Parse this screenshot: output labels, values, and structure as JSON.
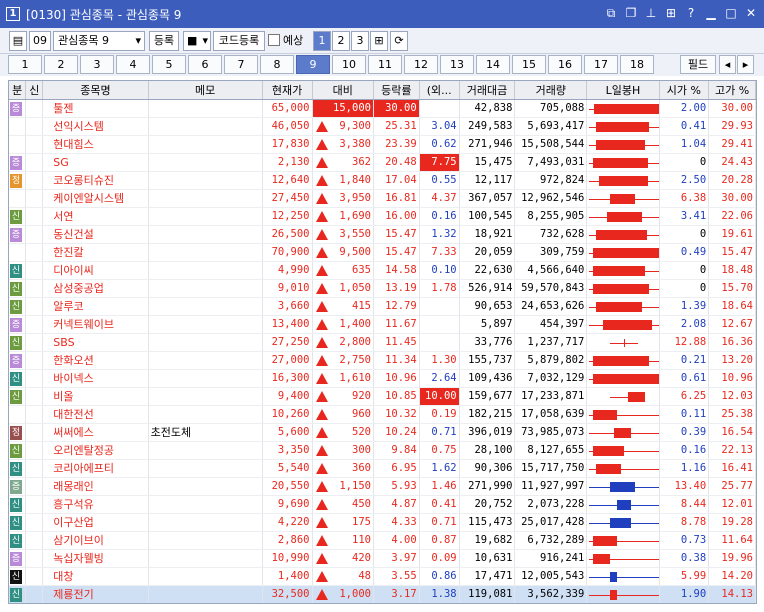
{
  "window": {
    "app_icon": "1",
    "title": "[0130] 관심종목 - 관심종목 9",
    "icons": [
      "restore-down-icon",
      "cascade-icon",
      "pin-icon",
      "grid-icon",
      "help-icon",
      "minimize-icon",
      "maximize-icon",
      "close-icon"
    ]
  },
  "toolbar": {
    "group_number": "09",
    "group_select": "관심종목 9",
    "register_label": "등록",
    "code_register_label": "코드등록",
    "forecast_label": "예상",
    "page_buttons": [
      "1",
      "2",
      "3"
    ]
  },
  "tabs": [
    "1",
    "2",
    "3",
    "4",
    "5",
    "6",
    "7",
    "8",
    "9",
    "10",
    "11",
    "12",
    "13",
    "14",
    "15",
    "16",
    "17",
    "18"
  ],
  "active_tab": "9",
  "field_label": "필드",
  "columns": [
    "분",
    "신",
    "종목명",
    "메모",
    "현재가",
    "대비",
    "등락률",
    "(외...",
    "거래대금",
    "거래량",
    "L일봉H",
    "시가 %",
    "고가 %"
  ],
  "rows": [
    {
      "b": "증",
      "bt": "jeung",
      "s": "",
      "name": "툴젠",
      "memo": "",
      "price": "65,000",
      "arrow": "up-arrow",
      "diff": "15,000",
      "rate": "30.00",
      "foreign": "",
      "fcolor": "",
      "amount": "42,838",
      "volume": "705,088",
      "open": "2.00",
      "high": "30.00",
      "candle": {
        "low": 0.0,
        "high": 1.0,
        "open": 0.07,
        "close": 1.0
      },
      "pricehl": false,
      "diffhl": true,
      "ratehl": true
    },
    {
      "b": "",
      "bt": "",
      "s": "",
      "name": "선익시스템",
      "memo": "",
      "price": "46,050",
      "arrow": "tri",
      "diff": "9,300",
      "rate": "25.31",
      "foreign": "3.04",
      "fcolor": "blue",
      "amount": "249,583",
      "volume": "5,693,417",
      "open": "0.41",
      "high": "29.93",
      "candle": {
        "low": 0.0,
        "high": 1.0,
        "open": 0.1,
        "close": 0.85
      }
    },
    {
      "b": "",
      "bt": "",
      "s": "",
      "name": "현대힘스",
      "memo": "",
      "price": "17,830",
      "arrow": "tri",
      "diff": "3,380",
      "rate": "23.39",
      "foreign": "0.62",
      "fcolor": "blue",
      "amount": "271,946",
      "volume": "15,508,544",
      "open": "1.04",
      "high": "29.41",
      "candle": {
        "low": 0.0,
        "high": 1.0,
        "open": 0.1,
        "close": 0.8
      }
    },
    {
      "b": "증",
      "bt": "jeung",
      "s": "",
      "name": "SG",
      "memo": "",
      "price": "2,130",
      "arrow": "tri",
      "diff": "362",
      "rate": "20.48",
      "foreign": "7.75",
      "fcolor": "hl",
      "amount": "15,475",
      "volume": "7,493,031",
      "open": "0",
      "high": "24.43",
      "candle": {
        "low": 0.0,
        "high": 1.0,
        "open": 0.05,
        "close": 0.84
      }
    },
    {
      "b": "정",
      "bt": "jeong",
      "s": "",
      "name": "코오롱티슈진",
      "memo": "",
      "price": "12,640",
      "arrow": "tri",
      "diff": "1,840",
      "rate": "17.04",
      "foreign": "0.55",
      "fcolor": "blue",
      "amount": "12,117",
      "volume": "972,824",
      "open": "2.50",
      "high": "20.28",
      "candle": {
        "low": 0.0,
        "high": 1.0,
        "open": 0.14,
        "close": 0.84
      }
    },
    {
      "b": "",
      "bt": "",
      "s": "",
      "name": "케이엔알시스템",
      "memo": "",
      "price": "27,450",
      "arrow": "tri",
      "diff": "3,950",
      "rate": "16.81",
      "foreign": "4.37",
      "fcolor": "red",
      "amount": "367,057",
      "volume": "12,962,546",
      "open": "6.38",
      "high": "30.00",
      "candle": {
        "low": 0.0,
        "high": 1.0,
        "open": 0.3,
        "close": 0.65
      }
    },
    {
      "b": "신",
      "bt": "sin",
      "s": "",
      "name": "서연",
      "memo": "",
      "price": "12,250",
      "arrow": "tri",
      "diff": "1,690",
      "rate": "16.00",
      "foreign": "0.16",
      "fcolor": "blue",
      "amount": "100,545",
      "volume": "8,255,905",
      "open": "3.41",
      "high": "22.06",
      "candle": {
        "low": 0.0,
        "high": 1.0,
        "open": 0.25,
        "close": 0.75
      }
    },
    {
      "b": "증",
      "bt": "jeung",
      "s": "",
      "name": "동신건설",
      "memo": "",
      "price": "26,500",
      "arrow": "tri",
      "diff": "3,550",
      "rate": "15.47",
      "foreign": "1.32",
      "fcolor": "blue",
      "amount": "18,921",
      "volume": "732,628",
      "open": "0",
      "high": "19.61",
      "candle": {
        "low": 0.0,
        "high": 1.0,
        "open": 0.1,
        "close": 0.82
      }
    },
    {
      "b": "",
      "bt": "",
      "s": "",
      "name": "한진칼",
      "memo": "",
      "price": "70,900",
      "arrow": "tri",
      "diff": "9,500",
      "rate": "15.47",
      "foreign": "7.33",
      "fcolor": "red",
      "amount": "20,059",
      "volume": "309,759",
      "open": "0.49",
      "high": "15.47",
      "candle": {
        "low": 0.0,
        "high": 1.0,
        "open": 0.05,
        "close": 1.0
      }
    },
    {
      "b": "신",
      "bt": "sin2",
      "s": "",
      "name": "디아이씨",
      "memo": "",
      "price": "4,990",
      "arrow": "tri",
      "diff": "635",
      "rate": "14.58",
      "foreign": "0.10",
      "fcolor": "blue",
      "amount": "22,630",
      "volume": "4,566,640",
      "open": "0",
      "high": "18.48",
      "candle": {
        "low": 0.0,
        "high": 1.0,
        "open": 0.05,
        "close": 0.8
      }
    },
    {
      "b": "신",
      "bt": "sin",
      "s": "",
      "name": "삼성중공업",
      "memo": "",
      "price": "9,010",
      "arrow": "tri",
      "diff": "1,050",
      "rate": "13.19",
      "foreign": "1.78",
      "fcolor": "red",
      "amount": "526,914",
      "volume": "59,570,843",
      "open": "0",
      "high": "15.70",
      "candle": {
        "low": 0.0,
        "high": 1.0,
        "open": 0.05,
        "close": 0.85
      }
    },
    {
      "b": "신",
      "bt": "sin",
      "s": "",
      "name": "알루코",
      "memo": "",
      "price": "3,660",
      "arrow": "tri",
      "diff": "415",
      "rate": "12.79",
      "foreign": "",
      "fcolor": "",
      "amount": "90,653",
      "volume": "24,653,626",
      "open": "1.39",
      "high": "18.64",
      "candle": {
        "low": 0.0,
        "high": 1.0,
        "open": 0.1,
        "close": 0.75
      }
    },
    {
      "b": "증",
      "bt": "jeung",
      "s": "",
      "name": "커넥트웨이브",
      "memo": "",
      "price": "13,400",
      "arrow": "tri",
      "diff": "1,400",
      "rate": "11.67",
      "foreign": "",
      "fcolor": "",
      "amount": "5,897",
      "volume": "454,397",
      "open": "2.08",
      "high": "12.67",
      "candle": {
        "low": 0.0,
        "high": 1.0,
        "open": 0.2,
        "close": 0.9
      }
    },
    {
      "b": "신",
      "bt": "sin",
      "s": "",
      "name": "SBS",
      "memo": "",
      "price": "27,250",
      "arrow": "tri",
      "diff": "2,800",
      "rate": "11.45",
      "foreign": "",
      "fcolor": "",
      "amount": "33,776",
      "volume": "1,237,717",
      "open": "12.88",
      "high": "16.36",
      "candle": {
        "low": 0.3,
        "high": 0.7,
        "open": 0.48,
        "close": 0.52,
        "flat": true
      }
    },
    {
      "b": "증",
      "bt": "jeung",
      "s": "",
      "name": "한화오션",
      "memo": "",
      "price": "27,000",
      "arrow": "tri",
      "diff": "2,750",
      "rate": "11.34",
      "foreign": "1.30",
      "fcolor": "red",
      "amount": "155,737",
      "volume": "5,879,802",
      "open": "0.21",
      "high": "13.20",
      "candle": {
        "low": 0.0,
        "high": 1.0,
        "open": 0.05,
        "close": 0.85
      }
    },
    {
      "b": "신",
      "bt": "sin2",
      "s": "",
      "name": "바이넥스",
      "memo": "",
      "price": "16,300",
      "arrow": "tri",
      "diff": "1,610",
      "rate": "10.96",
      "foreign": "2.64",
      "fcolor": "blue",
      "amount": "109,436",
      "volume": "7,032,129",
      "open": "0.61",
      "high": "10.96",
      "candle": {
        "low": 0.0,
        "high": 1.0,
        "open": 0.05,
        "close": 1.0
      }
    },
    {
      "b": "신",
      "bt": "sin",
      "s": "",
      "name": "비올",
      "memo": "",
      "price": "9,400",
      "arrow": "tri",
      "diff": "920",
      "rate": "10.85",
      "foreign": "10.00",
      "fcolor": "hl",
      "amount": "159,677",
      "volume": "17,233,871",
      "open": "6.25",
      "high": "12.03",
      "candle": {
        "low": 0.3,
        "high": 0.8,
        "open": 0.55,
        "close": 0.8
      }
    },
    {
      "b": "",
      "bt": "",
      "s": "",
      "name": "대한전선",
      "memo": "",
      "price": "10,260",
      "arrow": "tri",
      "diff": "960",
      "rate": "10.32",
      "foreign": "0.19",
      "fcolor": "red",
      "amount": "182,215",
      "volume": "17,058,639",
      "open": "0.11",
      "high": "25.38",
      "candle": {
        "low": 0.0,
        "high": 1.0,
        "open": 0.05,
        "close": 0.4
      }
    },
    {
      "b": "정",
      "bt": "jeong2",
      "s": "",
      "name": "써써에스",
      "memo": "초전도체",
      "price": "5,600",
      "arrow": "tri",
      "diff": "520",
      "rate": "10.24",
      "foreign": "0.71",
      "fcolor": "blue",
      "amount": "396,019",
      "volume": "73,985,073",
      "open": "0.39",
      "high": "16.54",
      "candle": {
        "low": 0.0,
        "high": 1.0,
        "open": 0.35,
        "close": 0.6
      }
    },
    {
      "b": "신",
      "bt": "sin",
      "s": "",
      "name": "오리엔탈정공",
      "memo": "",
      "price": "3,350",
      "arrow": "tri",
      "diff": "300",
      "rate": "9.84",
      "foreign": "0.75",
      "fcolor": "red",
      "amount": "28,100",
      "volume": "8,127,655",
      "open": "0.16",
      "high": "22.13",
      "candle": {
        "low": 0.0,
        "high": 1.0,
        "open": 0.05,
        "close": 0.5
      }
    },
    {
      "b": "신",
      "bt": "sin2",
      "s": "",
      "name": "코리아에프티",
      "memo": "",
      "price": "5,540",
      "arrow": "tri",
      "diff": "360",
      "rate": "6.95",
      "foreign": "1.62",
      "fcolor": "blue",
      "amount": "90,306",
      "volume": "15,717,750",
      "open": "1.16",
      "high": "16.41",
      "candle": {
        "low": 0.0,
        "high": 1.0,
        "open": 0.1,
        "close": 0.45
      }
    },
    {
      "b": "증",
      "bt": "jeung2",
      "s": "",
      "name": "래몽래인",
      "memo": "",
      "price": "20,550",
      "arrow": "tri",
      "diff": "1,150",
      "rate": "5.93",
      "foreign": "1.46",
      "fcolor": "red",
      "amount": "271,990",
      "volume": "11,927,997",
      "open": "13.40",
      "high": "25.77",
      "candle": {
        "low": 0.0,
        "high": 1.0,
        "open": 0.65,
        "close": 0.3,
        "blue": true
      }
    },
    {
      "b": "신",
      "bt": "sin2",
      "s": "",
      "name": "흥구석유",
      "memo": "",
      "price": "9,690",
      "arrow": "tri",
      "diff": "450",
      "rate": "4.87",
      "foreign": "0.41",
      "fcolor": "red",
      "amount": "20,752",
      "volume": "2,073,228",
      "open": "8.44",
      "high": "12.01",
      "candle": {
        "low": 0.0,
        "high": 1.0,
        "open": 0.6,
        "close": 0.4,
        "blue": true
      }
    },
    {
      "b": "신",
      "bt": "sin2",
      "s": "",
      "name": "이구산업",
      "memo": "",
      "price": "4,220",
      "arrow": "tri",
      "diff": "175",
      "rate": "4.33",
      "foreign": "0.71",
      "fcolor": "red",
      "amount": "115,473",
      "volume": "25,017,428",
      "open": "8.78",
      "high": "19.28",
      "candle": {
        "low": 0.0,
        "high": 1.0,
        "open": 0.6,
        "close": 0.3,
        "blue": true
      }
    },
    {
      "b": "신",
      "bt": "sin2",
      "s": "",
      "name": "삼기이브이",
      "memo": "",
      "price": "2,860",
      "arrow": "tri",
      "diff": "110",
      "rate": "4.00",
      "foreign": "0.87",
      "fcolor": "red",
      "amount": "19,682",
      "volume": "6,732,289",
      "open": "0.73",
      "high": "11.64",
      "candle": {
        "low": 0.0,
        "high": 1.0,
        "open": 0.05,
        "close": 0.4
      }
    },
    {
      "b": "증",
      "bt": "jeung",
      "s": "",
      "name": "녹십자웰빙",
      "memo": "",
      "price": "10,990",
      "arrow": "tri",
      "diff": "420",
      "rate": "3.97",
      "foreign": "0.09",
      "fcolor": "red",
      "amount": "10,631",
      "volume": "916,241",
      "open": "0.38",
      "high": "19.96",
      "candle": {
        "low": 0.0,
        "high": 1.0,
        "open": 0.05,
        "close": 0.3
      }
    },
    {
      "b": "신",
      "bt": "sin2b",
      "s": "",
      "name": "대창",
      "memo": "",
      "price": "1,400",
      "arrow": "tri",
      "diff": "48",
      "rate": "3.55",
      "foreign": "0.86",
      "fcolor": "blue",
      "amount": "17,471",
      "volume": "12,005,543",
      "open": "5.99",
      "high": "14.20",
      "candle": {
        "low": 0.0,
        "high": 1.0,
        "open": 0.4,
        "close": 0.3,
        "blue": true
      }
    },
    {
      "b": "신",
      "bt": "sin2",
      "s": "",
      "name": "제룡전기",
      "memo": "",
      "price": "32,500",
      "arrow": "tri",
      "diff": "1,000",
      "rate": "3.17",
      "foreign": "1.38",
      "fcolor": "blue",
      "amount": "119,081",
      "volume": "3,562,339",
      "open": "1.90",
      "high": "14.13",
      "candle": {
        "low": 0.0,
        "high": 1.0,
        "open": 0.3,
        "close": 0.4
      },
      "selected": true
    }
  ]
}
